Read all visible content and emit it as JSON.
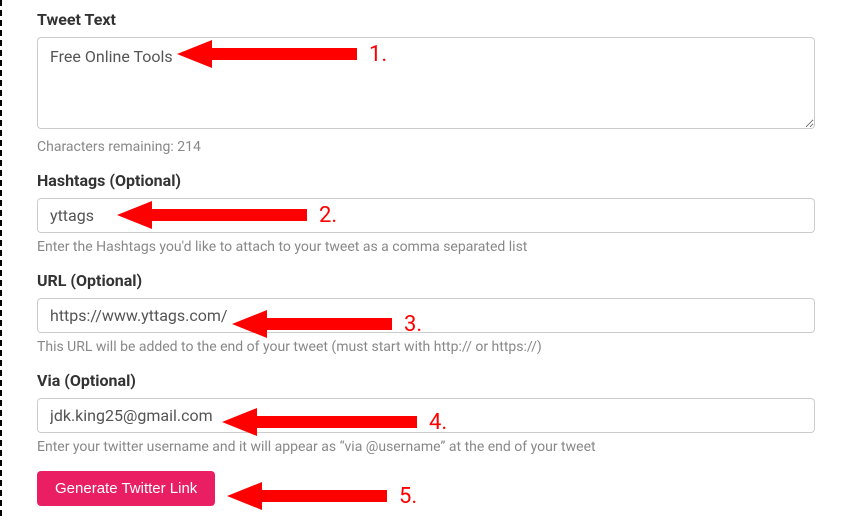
{
  "tweetText": {
    "label": "Tweet Text",
    "value": "Free Online Tools",
    "charactersRemaining": "Characters remaining: 214"
  },
  "hashtags": {
    "label": "Hashtags (Optional)",
    "value": "yttags",
    "help": "Enter the Hashtags you'd like to attach to your tweet as a comma separated list"
  },
  "url": {
    "label": "URL (Optional)",
    "value": "https://www.yttags.com/",
    "help": "This URL will be added to the end of your tweet (must start with http:// or https://)"
  },
  "via": {
    "label": "Via (Optional)",
    "value": "jdk.king25@gmail.com",
    "help": "Enter your twitter username and it will appear as “via @username” at the end of your tweet"
  },
  "button": {
    "label": "Generate Twitter Link"
  },
  "annotations": {
    "n1": "1.",
    "n2": "2.",
    "n3": "3.",
    "n4": "4.",
    "n5": "5."
  },
  "colors": {
    "accent": "#e91e63",
    "annotation": "#ff0000"
  }
}
